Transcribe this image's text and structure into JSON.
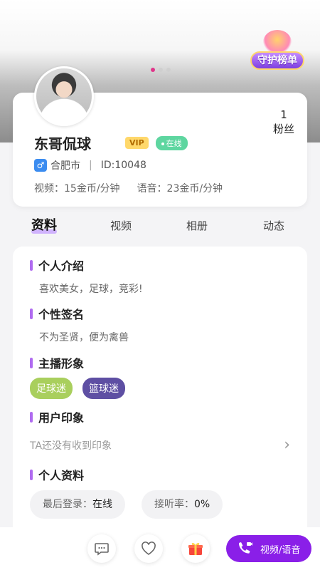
{
  "banner": {
    "carousel_dots": 3,
    "active_dot": 0,
    "guard_rank_label": "守护榜单"
  },
  "profile": {
    "name": "东哥侃球",
    "vip_label": "VIP",
    "online_label": "在线",
    "gender_symbol": "♂",
    "city": "合肥市",
    "separator": "|",
    "id_text": "ID:10048",
    "video_price": "视频：15金币/分钟",
    "voice_price": "语音：23金币/分钟",
    "fans_count": "1",
    "fans_label": "粉丝"
  },
  "tabs": [
    {
      "label": "资料",
      "active": true
    },
    {
      "label": "视频",
      "active": false
    },
    {
      "label": "相册",
      "active": false
    },
    {
      "label": "动态",
      "active": false
    }
  ],
  "sections": {
    "intro_title": "个人介绍",
    "intro_text": "喜欢美女，足球，竞彩!",
    "signature_title": "个性签名",
    "signature_text": "不为圣贤，便为禽兽",
    "image_title": "主播形象",
    "tags": [
      "足球迷",
      "篮球迷"
    ],
    "impression_title": "用户印象",
    "impression_text": "TA还没有收到印象",
    "info_title": "个人资料",
    "last_login_label": "最后登录：",
    "last_login_value": "在线",
    "answer_rate_label": "接听率：",
    "answer_rate_value": "0%"
  },
  "bottom_bar": {
    "call_label": "视频/语音",
    "icons": [
      "message-icon",
      "heart-icon",
      "gift-icon",
      "phone-icon"
    ]
  },
  "colors": {
    "accent_purple": "#8a1fe8",
    "section_bar": "#b06bf0",
    "vip_yellow": "#ffd86b",
    "online_green": "#5ed6a0",
    "tag_green": "#a9cf5d",
    "tag_purple": "#5e4fa3",
    "active_dot": "#e0368a",
    "gender_blue": "#3b8cf0"
  }
}
